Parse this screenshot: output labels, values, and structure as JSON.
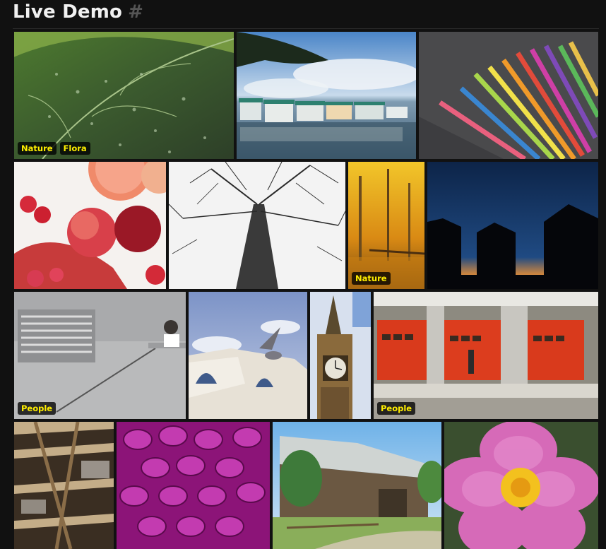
{
  "header": {
    "title": "Live Demo",
    "anchor": "#"
  },
  "gallery": {
    "tiles": [
      {
        "subject": "leaf with water drops",
        "tags": [
          "Nature",
          "Flora"
        ]
      },
      {
        "subject": "boats on lake",
        "tags": []
      },
      {
        "subject": "colored pencils",
        "tags": []
      },
      {
        "subject": "apples grapefruit strawberries",
        "tags": []
      },
      {
        "subject": "bare tree looking up",
        "tags": []
      },
      {
        "subject": "autumn forest reflection",
        "tags": [
          "Nature"
        ]
      },
      {
        "subject": "sheds silhouette at dusk",
        "tags": []
      },
      {
        "subject": "concrete wall with person",
        "tags": [
          "People"
        ]
      },
      {
        "subject": "bird over white building",
        "tags": []
      },
      {
        "subject": "clock tower",
        "tags": []
      },
      {
        "subject": "fire station doors",
        "tags": [
          "People"
        ]
      },
      {
        "subject": "wooden beams ceiling",
        "tags": []
      },
      {
        "subject": "magenta dahlia petals",
        "tags": []
      },
      {
        "subject": "old wooden barn",
        "tags": []
      },
      {
        "subject": "pink cosmos flower",
        "tags": []
      }
    ]
  }
}
